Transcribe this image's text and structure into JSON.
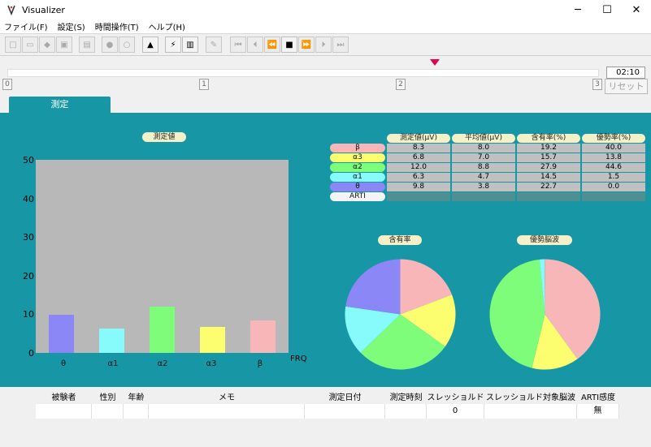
{
  "window": {
    "title": "Visualizer",
    "controls": [
      "─",
      "☐",
      "✕"
    ]
  },
  "menu": [
    "ファイル(F)",
    "設定(S)",
    "時間操作(T)",
    "ヘルプ(H)"
  ],
  "timeline": {
    "time": "02:10",
    "ticks": [
      "0",
      "1",
      "2",
      "3"
    ],
    "reset_label": "リセット",
    "marker_fraction": 0.7
  },
  "tabs": [
    {
      "label": "測定"
    }
  ],
  "bar_chart_title": "測定値",
  "table": {
    "headers": [
      "測定値(μV)",
      "平均値(μV)",
      "含有率(%)",
      "優勢率(%)"
    ],
    "rows": [
      {
        "label": "β",
        "color": "#f9b6b8",
        "values": [
          "8.3",
          "8.0",
          "19.2",
          "40.0"
        ]
      },
      {
        "label": "α3",
        "color": "#fdfd70",
        "values": [
          "6.8",
          "7.0",
          "15.7",
          "13.8"
        ]
      },
      {
        "label": "α2",
        "color": "#7dfd79",
        "values": [
          "12.0",
          "8.8",
          "27.9",
          "44.6"
        ]
      },
      {
        "label": "α1",
        "color": "#87fbfc",
        "values": [
          "6.3",
          "4.7",
          "14.5",
          "1.5"
        ]
      },
      {
        "label": "θ",
        "color": "#8b87f7",
        "values": [
          "9.8",
          "3.8",
          "22.7",
          "0.0"
        ]
      },
      {
        "label": "ARTI",
        "color": "#f4f4f4",
        "values": [
          "",
          "",
          "",
          ""
        ]
      }
    ]
  },
  "pie1_title": "含有率",
  "pie2_title": "優勢脳波",
  "chart_data": [
    {
      "type": "bar",
      "title": "測定値",
      "xlabel": "FRQ",
      "categories": [
        "θ",
        "α1",
        "α2",
        "α3",
        "β"
      ],
      "colors": [
        "#8b87f7",
        "#87fbfc",
        "#7dfd79",
        "#fdfd70",
        "#f9b6b8"
      ],
      "values": [
        9.8,
        6.3,
        12.0,
        6.8,
        8.3
      ],
      "yticks": [
        "0",
        "10",
        "20",
        "30",
        "40",
        "50"
      ],
      "ylim": [
        0,
        50
      ]
    },
    {
      "type": "pie",
      "title": "含有率",
      "labels": [
        "β",
        "α3",
        "α2",
        "α1",
        "θ"
      ],
      "colors": [
        "#f9b6b8",
        "#fdfd70",
        "#7dfd79",
        "#87fbfc",
        "#8b87f7"
      ],
      "values": [
        19.2,
        15.7,
        27.9,
        14.5,
        22.7
      ]
    },
    {
      "type": "pie",
      "title": "優勢脳波",
      "labels": [
        "β",
        "α3",
        "α2",
        "α1",
        "θ",
        "ARTI"
      ],
      "colors": [
        "#f9b6b8",
        "#fdfd70",
        "#7dfd79",
        "#87fbfc",
        "#8b87f7",
        "#b4b4b4"
      ],
      "values": [
        40.0,
        13.8,
        44.6,
        1.5,
        0.0
      ]
    }
  ],
  "info": {
    "headers": [
      "被験者",
      "性別",
      "年齢",
      "メモ",
      "測定日付",
      "測定時刻",
      "スレッショルド",
      "スレッショルド対象脳波",
      "ARTI感度"
    ],
    "values": [
      "",
      "",
      "",
      "",
      "",
      "",
      "0",
      "",
      "無"
    ]
  }
}
